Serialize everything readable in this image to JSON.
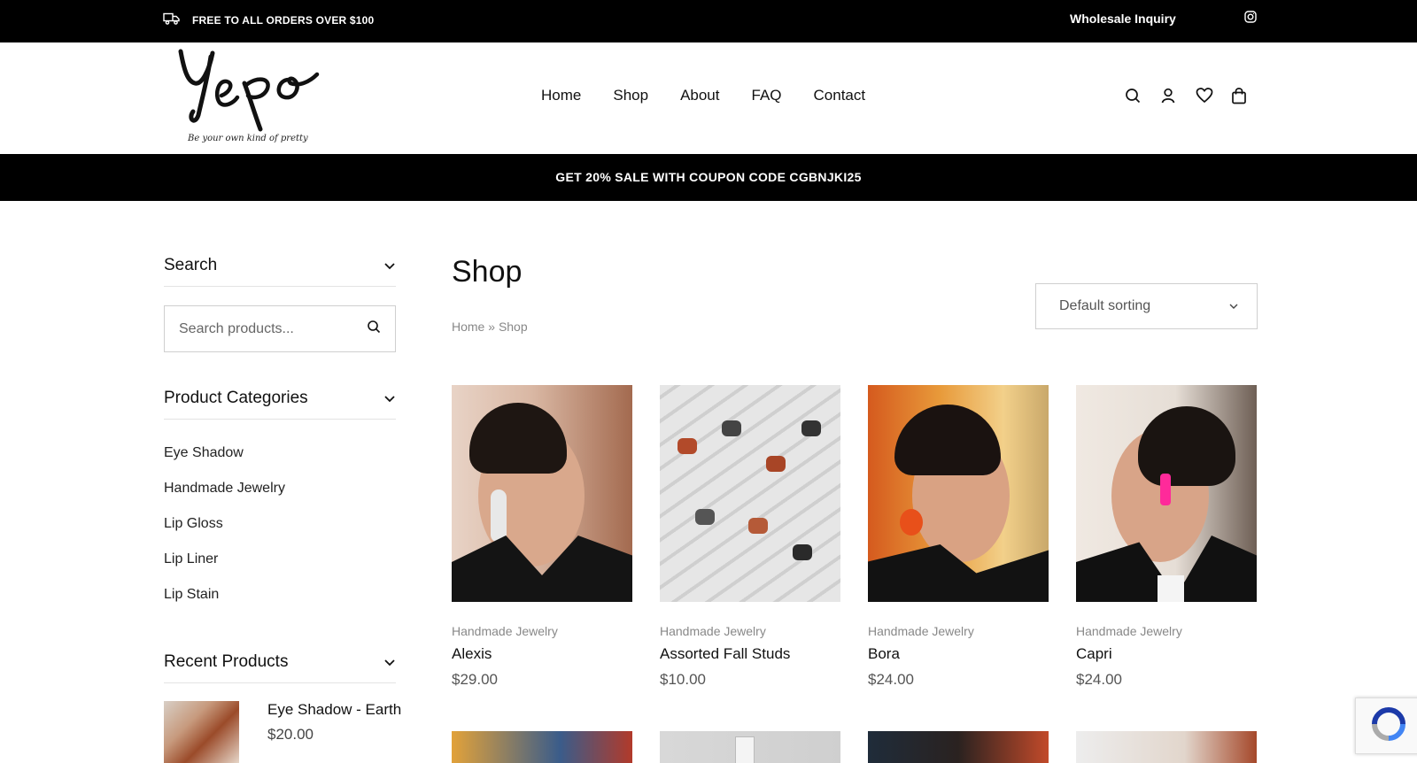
{
  "topbar": {
    "shipping_text": "FREE TO ALL ORDERS OVER $100",
    "wholesale_label": "Wholesale Inquiry",
    "icons": [
      "truck-icon",
      "instagram-icon"
    ]
  },
  "header": {
    "logo_text": "Yepo",
    "logo_tagline": "Be your own kind of pretty",
    "nav": [
      "Home",
      "Shop",
      "About",
      "FAQ",
      "Contact"
    ],
    "icons": [
      "search-icon",
      "user-icon",
      "heart-icon",
      "bag-icon"
    ]
  },
  "promo": {
    "text": "GET 20% SALE WITH COUPON CODE CGBNJKI25"
  },
  "sidebar": {
    "search_heading": "Search",
    "search_placeholder": "Search products...",
    "categories_heading": "Product Categories",
    "categories": [
      "Eye Shadow",
      "Handmade Jewelry",
      "Lip Gloss",
      "Lip Liner",
      "Lip Stain"
    ],
    "recent_heading": "Recent Products",
    "recent": [
      {
        "name": "Eye Shadow - Earth",
        "price": "$20.00"
      }
    ]
  },
  "main": {
    "title": "Shop",
    "breadcrumb": [
      "Home",
      "»",
      "Shop"
    ],
    "sorting": "Default sorting",
    "products": [
      {
        "category": "Handmade Jewelry",
        "name": "Alexis",
        "price": "$29.00"
      },
      {
        "category": "Handmade Jewelry",
        "name": "Assorted Fall Studs",
        "price": "$10.00"
      },
      {
        "category": "Handmade Jewelry",
        "name": "Bora",
        "price": "$24.00"
      },
      {
        "category": "Handmade Jewelry",
        "name": "Capri",
        "price": "$24.00"
      }
    ]
  },
  "colors": {
    "topbar_bg": "#000000",
    "promo_bg": "#000000",
    "text": "#111111",
    "muted": "#888888"
  }
}
